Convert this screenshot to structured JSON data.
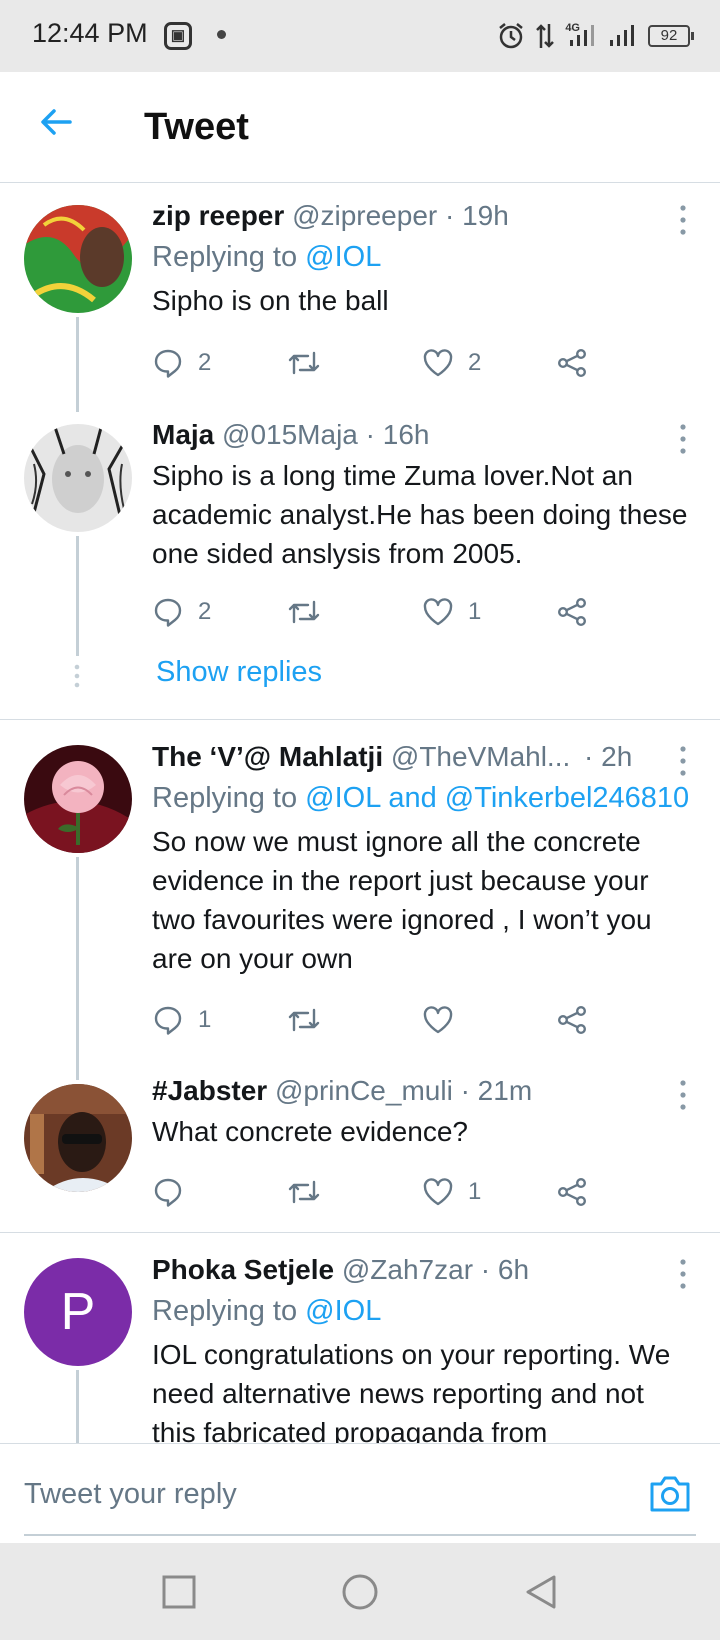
{
  "status_bar": {
    "time": "12:44 PM",
    "battery": "92",
    "network": "4G"
  },
  "header": {
    "title": "Tweet"
  },
  "tweets": [
    {
      "name": "zip reeper",
      "handle": "@zipreeper",
      "time": "· 19h",
      "replying_prefix": "Replying to ",
      "replying_to": "@IOL",
      "text": "Sipho is on the ball",
      "replies": "2",
      "retweets": "",
      "likes": "2"
    },
    {
      "name": "Maja",
      "handle": "@015Maja",
      "time": "· 16h",
      "text": "Sipho is a long time Zuma lover.Not an academic analyst.He has been doing these one sided anslysis from 2005.",
      "replies": "2",
      "retweets": "",
      "likes": "1"
    },
    {
      "name": "The ‘V’@ Mahlatji",
      "handle": "@TheVMahl...",
      "time": "· 2h",
      "replying_prefix": "Replying to ",
      "replying_to": "@IOL and @Tinkerbel246810",
      "text": "So now we must ignore all the concrete evidence in the report just because your two favourites were ignored , I won’t you are on your own",
      "replies": "1",
      "retweets": "",
      "likes": ""
    },
    {
      "name": "#Jabster",
      "handle": "@prinCe_muli",
      "time": "· 21m",
      "text": "What concrete evidence?",
      "replies": "",
      "retweets": "",
      "likes": "1"
    },
    {
      "name": "Phoka Setjele",
      "handle": "@Zah7zar",
      "time": "· 6h",
      "replying_prefix": "Replying to ",
      "replying_to": "@IOL",
      "text": "IOL congratulations on your reporting. We need alternative news reporting and not this fabricated propaganda from",
      "avatar_letter": "P"
    }
  ],
  "show_replies": "Show replies",
  "compose": {
    "placeholder": "Tweet your reply"
  },
  "icons": {
    "back": "back-arrow-icon",
    "reply": "reply-icon",
    "retweet": "retweet-icon",
    "like": "heart-icon",
    "share": "share-icon",
    "more": "more-vertical-icon",
    "camera": "camera-icon"
  },
  "colors": {
    "accent": "#1da1f2",
    "muted": "#657786",
    "divider": "#d6dde3",
    "avatar_purple": "#7b2ca8"
  }
}
